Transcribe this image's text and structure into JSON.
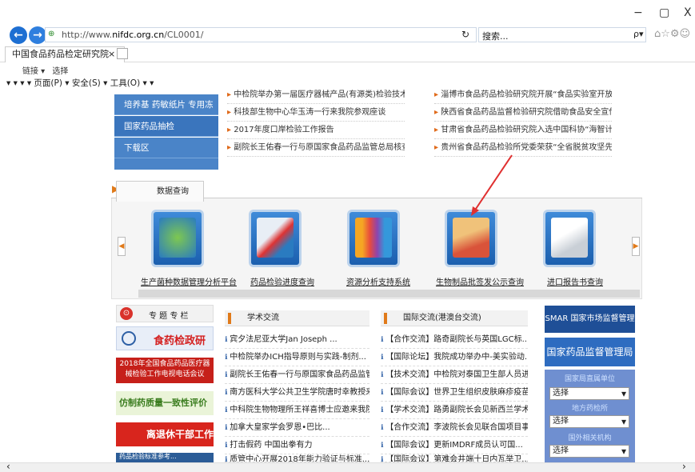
{
  "window": {
    "min": "−",
    "restore": "▢",
    "close": "X"
  },
  "nav": {
    "back": "←",
    "forward": "→"
  },
  "address": {
    "url_prefix": "http://www.",
    "url_domain": "nifdc.org.cn",
    "url_path": "/CL0001/",
    "refresh": "↻"
  },
  "search": {
    "placeholder": "搜索...",
    "icon": "ρ▾"
  },
  "toolbar_icons": "⌂☆⚙☺",
  "tab": {
    "title": "中国食品药品检定研究院",
    "close": "×"
  },
  "favorites": {
    "items": [
      "链接 ▾",
      "选择"
    ]
  },
  "commandbar": {
    "text": "▾  ▾  ▾  ▾ 页面(P) ▾  安全(S) ▾  工具(O) ▾  ▾"
  },
  "leftmenu": [
    "培养基 药敏纸片 专用冻干品",
    "国家药品抽检",
    "下载区"
  ],
  "news_left": [
    "中检院举办第一届医疗器械产品(有源类)检验技术...",
    "科技部生物中心华玉涛一行来我院参观座谈",
    "2017年度口岸检验工作报告",
    "副院长王佑春一行与原国家食品药品监管总局核查中..."
  ],
  "news_right": [
    "淄博市食品药品检验研究院开展“食品实验室开放日...",
    "陕西省食品药品监督检验研究院借助食品安全宣传周...",
    "甘肃省食品药品检验研究院入选中国科协“海智计划”甘...",
    "贵州省食品药品检验所党委荣获“全省脱贫攻坚先进..."
  ],
  "dataquery": {
    "tab": "数据查询",
    "items": [
      "生产菌种数据管理分析平台",
      "药品检验进度查询",
      "资源分析支持系统",
      "生物制品批签发公示查询",
      "进口报告书查询"
    ]
  },
  "special": {
    "title": "专 题 专 栏",
    "banners": [
      "食药检政研",
      "2018年全国食品药品医疗器械检验工作电视电话会议",
      "仿制药质量一致性评价",
      "离退休干部工作",
      "药品检验标准参考..."
    ]
  },
  "academic": {
    "title": "学术交流",
    "items": [
      "宾夕法尼亚大学Jan Joseph ...",
      "中检院举办ICH指导原则与实践-制剂...",
      "副院长王佑春一行与原国家食品药品监管...",
      "南方医科大学公共卫生学院唐时幸教授来...",
      "中科院生物物理所王祥喜博士应邀来我院...",
      "加拿大皇家学会罗恩•巴比...",
      "打击假药 中国出拳有力",
      "质管中心开展2018年能力验证与标准..."
    ]
  },
  "international": {
    "title": "国际交流(港澳台交流)",
    "items": [
      "【合作交流】路奇副院长与英国LGC标...",
      "【国际论坛】我院成功举办中-美实验动...",
      "【技术交流】中检院对泰国卫生部人员进...",
      "【国际会议】世界卫生组织皮肤麻疹疫苗...",
      "【学术交流】路勇副院长会见新西兰学术...",
      "【合作交流】李波院长会见联合国项目事...",
      "【国际会议】更新IMDRF成员认可国...",
      "【国际会议】第难会井端十日内瓦举卫..."
    ]
  },
  "rightcol": {
    "smar": "SMAR 国家市场监督管理总局",
    "nmpa": "国家药品监督管理局",
    "labels": [
      "国家局直属单位",
      "地方药检所",
      "国外相关机构"
    ],
    "select": "选择"
  },
  "hscroll": {
    "left": "‹",
    "right": "›"
  }
}
